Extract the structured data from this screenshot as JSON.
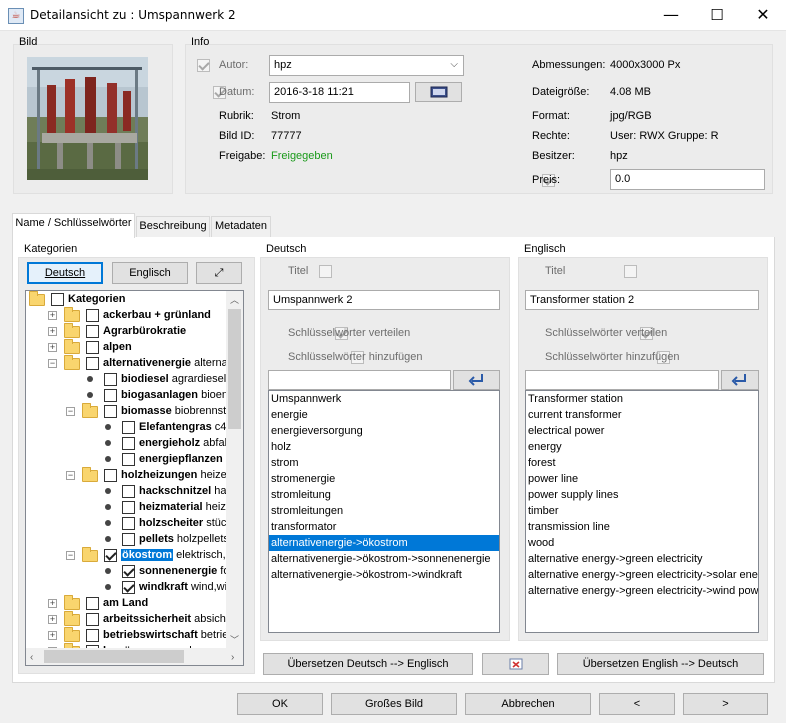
{
  "window": {
    "title": "Detailansicht zu : Umspannwerk 2",
    "minimize": "—",
    "maximize": "☐",
    "close": "✕"
  },
  "bild": {
    "label": "Bild"
  },
  "info": {
    "label": "Info",
    "autor_label": "Autor:",
    "autor_value": "hpz",
    "datum_label": "Datum:",
    "datum_value": "2016-3-18 11:21",
    "rubrik_label": "Rubrik:",
    "rubrik_value": "Strom",
    "bildid_label": "Bild ID:",
    "bildid_value": "77777",
    "freigabe_label": "Freigabe:",
    "freigabe_value": "Freigegeben",
    "freigabe_color": "#1a9a1a",
    "abmessungen_label": "Abmessungen:",
    "abmessungen_value": "4000x3000 Px",
    "dateigroesse_label": "Dateigröße:",
    "dateigroesse_value": "4.08 MB",
    "format_label": "Format:",
    "format_value": "jpg/RGB",
    "rechte_label": "Rechte:",
    "rechte_value": "User: RWX Gruppe: R",
    "besitzer_label": "Besitzer:",
    "besitzer_value": "hpz",
    "preis_label": "Preis:",
    "preis_value": "0.0"
  },
  "tabs": [
    "Name / Schlüsselwörter",
    "Beschreibung",
    "Metadaten"
  ],
  "kategorien": {
    "label": "Kategorien",
    "btn_deutsch": "Deutsch",
    "btn_englisch": "Englisch",
    "btn_expand": "⤢",
    "tree": [
      {
        "label": "Kategorien",
        "desc": "",
        "checked": false,
        "type": "root"
      },
      {
        "label": "ackerbau + grünland",
        "desc": "",
        "checked": false,
        "type": "folder"
      },
      {
        "label": "Agrarbürokratie",
        "desc": "",
        "checked": false,
        "type": "folder"
      },
      {
        "label": "alpen",
        "desc": "",
        "checked": false,
        "type": "folder"
      },
      {
        "label": "alternativenergie",
        "desc": "alternati",
        "checked": false,
        "type": "folder-open"
      },
      {
        "label": "biodiesel",
        "desc": "agrardiesel,bio",
        "checked": false,
        "type": "leaf"
      },
      {
        "label": "biogasanlagen",
        "desc": "bioener",
        "checked": false,
        "type": "leaf"
      },
      {
        "label": "biomasse",
        "desc": "biobrennstoff",
        "checked": false,
        "type": "folder-open"
      },
      {
        "label": "Elefantengras",
        "desc": "c4 pf",
        "checked": false,
        "type": "leaf"
      },
      {
        "label": "energieholz",
        "desc": "abfallho",
        "checked": false,
        "type": "leaf"
      },
      {
        "label": "energiepflanzen",
        "desc": "er",
        "checked": false,
        "type": "leaf"
      },
      {
        "label": "holzheizungen",
        "desc": "heizen n",
        "checked": false,
        "type": "folder-open"
      },
      {
        "label": "hackschnitzel",
        "desc": "hack",
        "checked": false,
        "type": "leaf"
      },
      {
        "label": "heizmaterial",
        "desc": "heizgu",
        "checked": false,
        "type": "leaf"
      },
      {
        "label": "holzscheiter",
        "desc": "stückg",
        "checked": false,
        "type": "leaf"
      },
      {
        "label": "pellets",
        "desc": "holzpellets,pe",
        "checked": false,
        "type": "leaf"
      },
      {
        "label": "ökostrom",
        "desc": "elektrisch,ele",
        "checked": true,
        "type": "folder-open"
      },
      {
        "label": "sonnenenergie",
        "desc": "foto",
        "checked": true,
        "type": "leaf"
      },
      {
        "label": "windkraft",
        "desc": "wind,wind",
        "checked": true,
        "type": "leaf"
      },
      {
        "label": "am Land",
        "desc": "",
        "checked": false,
        "type": "folder"
      },
      {
        "label": "arbeitssicherheit",
        "desc": "absicher",
        "checked": false,
        "type": "folder"
      },
      {
        "label": "betriebswirtschaft",
        "desc": "betrieb",
        "checked": false,
        "type": "folder"
      },
      {
        "label": "bewässerungen",
        "desc": "beregnen",
        "checked": false,
        "type": "folder"
      }
    ]
  },
  "deutsch": {
    "label": "Deutsch",
    "titel_label": "Titel",
    "titel_value": "Umspannwerk 2",
    "verteilen_label": "Schlüsselwörter verteilen",
    "hinzufuegen_label": "Schlüsselwörter hinzufügen",
    "keywords": [
      "Umspannwerk",
      "energie",
      "energieversorgung",
      "holz",
      "strom",
      "stromenergie",
      "stromleitung",
      "stromleitungen",
      "transformator",
      "alternativenergie->ökostrom",
      "alternativenergie->ökostrom->sonnenenergie",
      "alternativenergie->ökostrom->windkraft"
    ],
    "selected_index": 9
  },
  "englisch": {
    "label": "Englisch",
    "titel_label": "Titel",
    "titel_value": "Transformer station 2",
    "verteilen_label": "Schlüsselwörter verteilen",
    "hinzufuegen_label": "Schlüsselwörter hinzufügen",
    "keywords": [
      "Transformer station",
      "current transformer",
      "electrical power",
      "energy",
      "forest",
      "power line",
      "power supply lines",
      "timber",
      "transmission line",
      "wood",
      "alternative energy->green electricity",
      "alternative energy->green electricity->solar ene",
      "alternative energy->green electricity->wind pow"
    ]
  },
  "translate": {
    "de_to_en": "Übersetzen Deutsch --> Englisch",
    "en_to_de": "Übersetzen English --> Deutsch"
  },
  "footer": {
    "ok": "OK",
    "gross": "Großes Bild",
    "abbrechen": "Abbrechen",
    "prev": "<",
    "next": ">"
  }
}
